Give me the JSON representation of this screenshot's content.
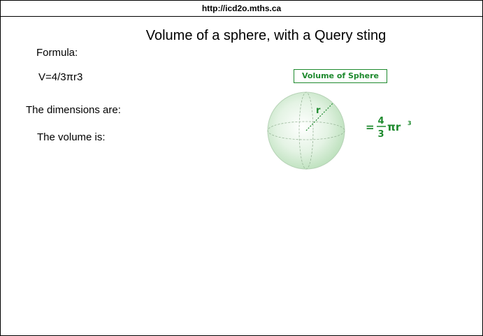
{
  "browser": {
    "url": "http://icd2o.mths.ca"
  },
  "page": {
    "title": "Volume of a sphere, with a Query sting",
    "formula_label": "Formula:",
    "formula_value": "V=4/3πr3",
    "dimensions_label": "The dimensions are:",
    "volume_label": "The volume is:"
  },
  "diagram": {
    "title": "Volume of Sphere",
    "radius_label": "r",
    "equals": "=",
    "numerator": "4",
    "denominator": "3",
    "pi_r": "πr",
    "exponent": "3",
    "accent_color": "#1e8a2e"
  }
}
